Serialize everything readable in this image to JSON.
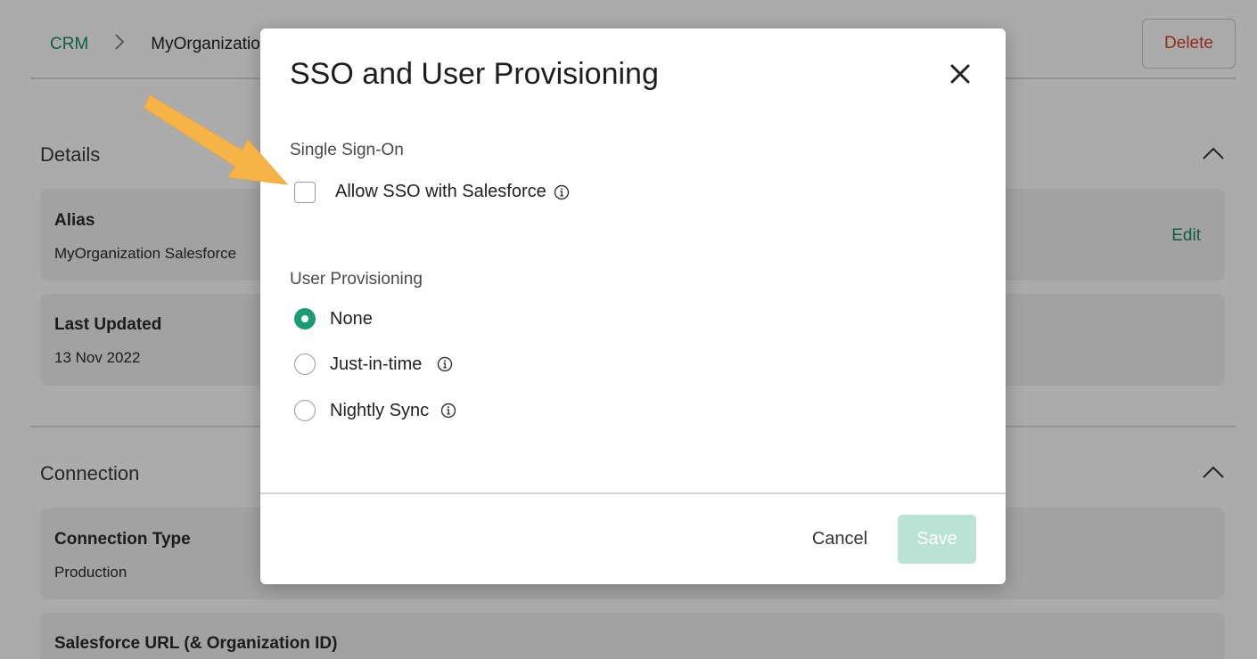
{
  "breadcrumb": {
    "root": "CRM",
    "current": "MyOrganization Salesforce"
  },
  "header": {
    "delete_label": "Delete"
  },
  "details": {
    "title": "Details",
    "alias": {
      "label": "Alias",
      "value": "MyOrganization Salesforce",
      "edit_label": "Edit"
    },
    "last_updated": {
      "label": "Last Updated",
      "value": "13 Nov 2022"
    }
  },
  "connection": {
    "title": "Connection",
    "type": {
      "label": "Connection Type",
      "value": "Production"
    },
    "url": {
      "label": "Salesforce URL (& Organization ID)"
    }
  },
  "modal": {
    "title": "SSO and User Provisioning",
    "sso": {
      "heading": "Single Sign-On",
      "checkbox_label": "Allow SSO with Salesforce",
      "checked": false
    },
    "provisioning": {
      "heading": "User Provisioning",
      "options": [
        {
          "label": "None",
          "selected": true,
          "info": false
        },
        {
          "label": "Just-in-time",
          "selected": false,
          "info": true
        },
        {
          "label": "Nightly Sync",
          "selected": false,
          "info": true
        }
      ]
    },
    "footer": {
      "cancel_label": "Cancel",
      "save_label": "Save"
    }
  },
  "colors": {
    "accent": "#1a9b73",
    "link": "#1b8a64",
    "danger": "#d8422c",
    "save_disabled": "#b9e3d4",
    "arrow": "#f7b446"
  },
  "icons": [
    "chevron-right-icon",
    "chevron-up-icon",
    "close-icon",
    "info-icon",
    "arrow-pointer-icon"
  ]
}
